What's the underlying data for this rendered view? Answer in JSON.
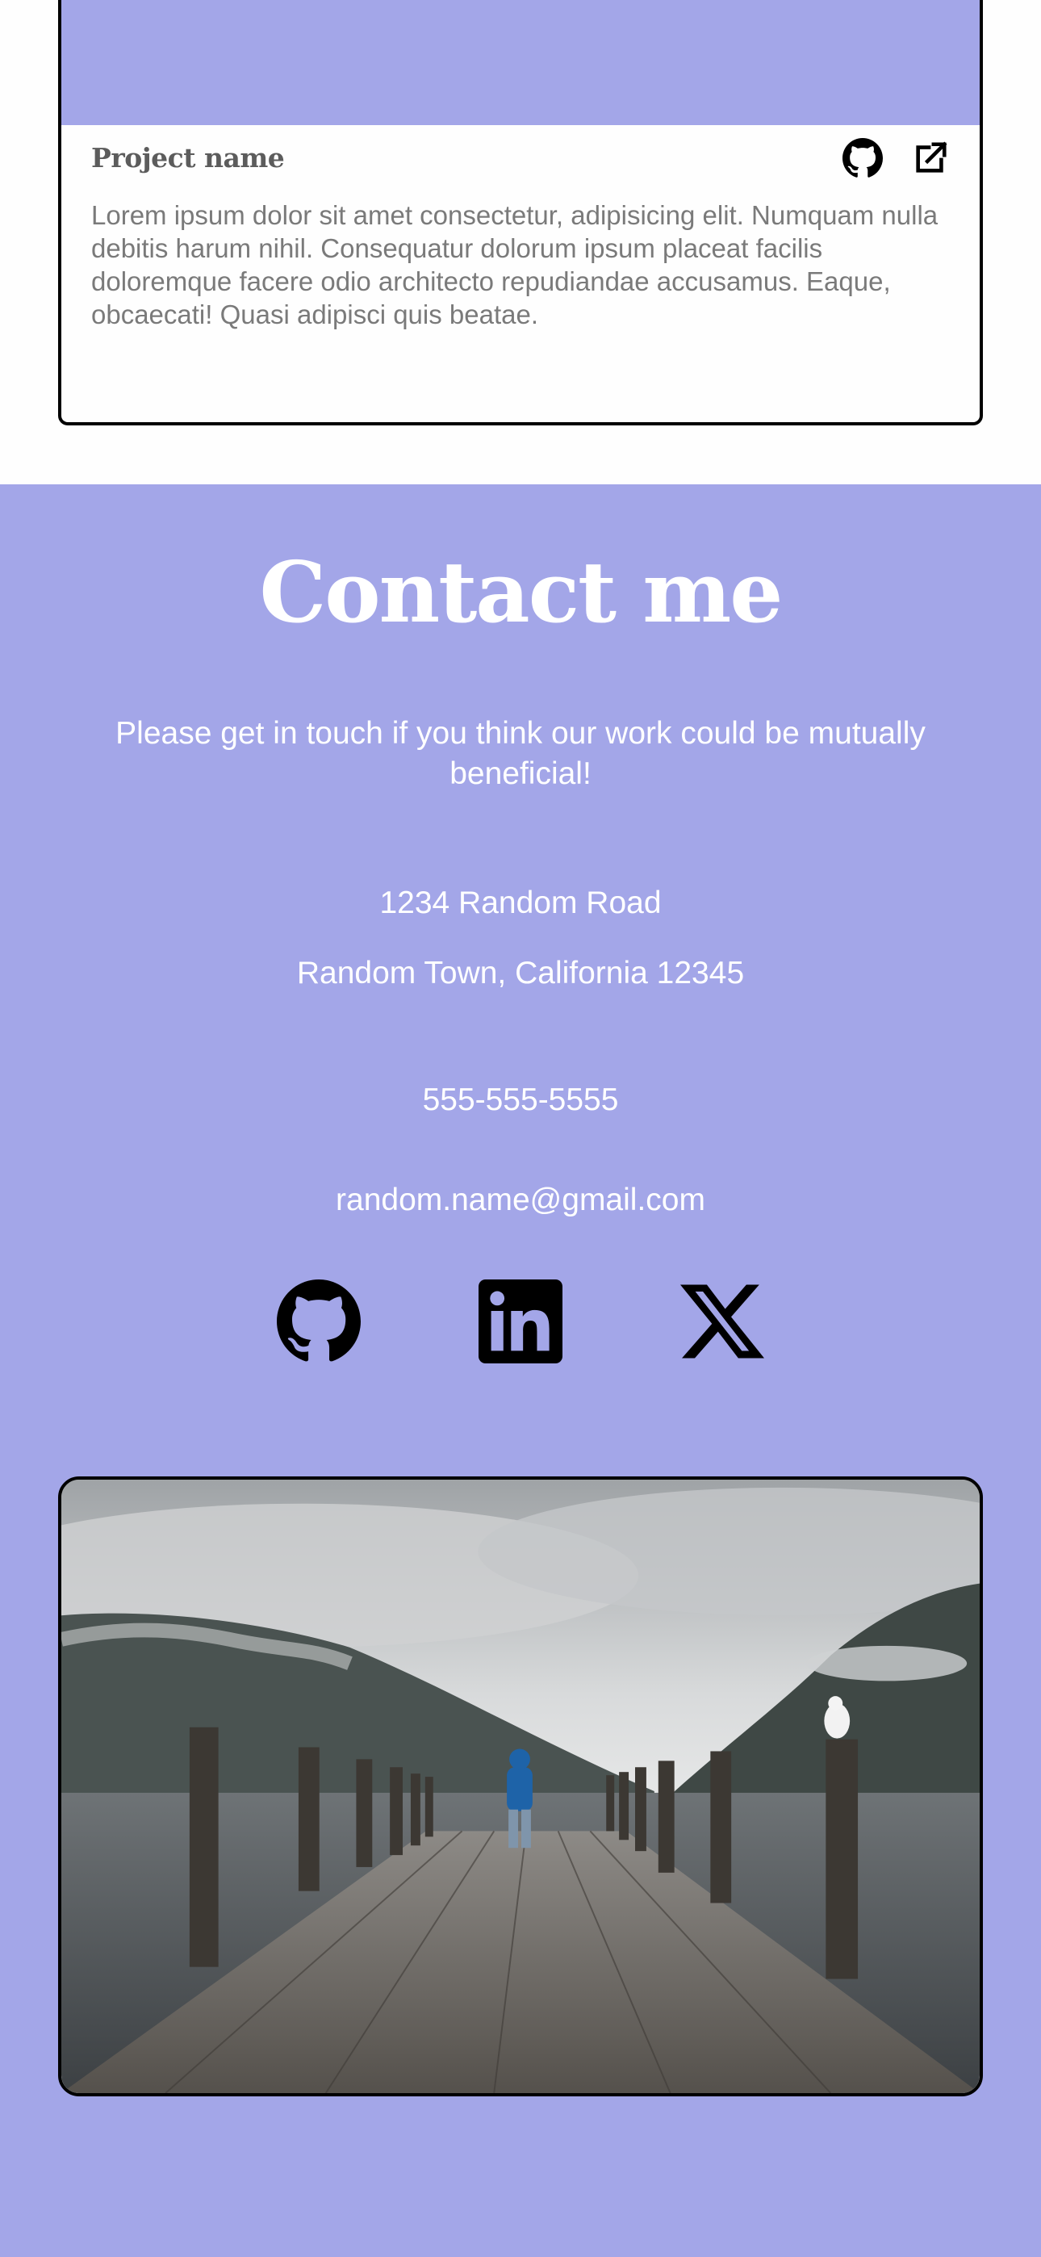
{
  "project": {
    "name": "Project name",
    "description": "Lorem ipsum dolor sit amet consectetur, adipisicing elit. Numquam nulla debitis harum nihil. Consequatur dolorum ipsum placeat facilis doloremque facere odio architecto repudiandae accusamus. Eaque, obcaecati! Quasi adipisci quis beatae.",
    "icons": [
      "github-icon",
      "external-link-icon"
    ]
  },
  "contact": {
    "title": "Contact me",
    "subtitle": "Please get in touch if you think our work could be mutually beneficial!",
    "address_line1": "1234 Random Road",
    "address_line2": "Random Town, California 12345",
    "phone": "555-555-5555",
    "email": "random.name@gmail.com",
    "socials": [
      "github-icon",
      "linkedin-icon",
      "x-icon"
    ]
  },
  "colors": {
    "accent": "#a3a6e8",
    "card_background": "#fefefe",
    "text_white": "#ffffff",
    "border": "#000000"
  }
}
